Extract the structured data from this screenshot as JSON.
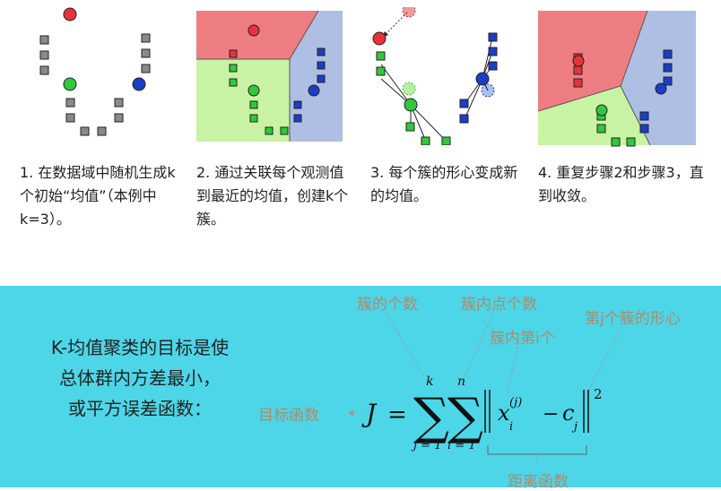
{
  "steps": [
    {
      "caption": "1. 在数据域中随机生成k个初始“均值”（本例中k=3）。"
    },
    {
      "caption": "2. 通过关联每个观测值到最近的均值，创建k个簇。"
    },
    {
      "caption": "3. 每个簇的形心变成新的均值。"
    },
    {
      "caption": "4. 重复步骤2和步骤3，直到收敛。"
    }
  ],
  "objective": {
    "line1": "K-均值聚类的目标是使",
    "line2": "总体群内方差最小，",
    "line3": "或平方误差函数："
  },
  "formula_labels": {
    "cluster_count": "簇的个数",
    "points_in_cluster": "簇内点个数",
    "ith_in_cluster": "簇内第i个",
    "jth_centroid": "第j个簇的形心",
    "objective_function": "目标函数",
    "distance_function": "距离函数"
  },
  "formula": {
    "J": "J",
    "eq": "=",
    "k": "k",
    "n": "n",
    "j1": "j = 1",
    "i1": "i = 1",
    "x": "x",
    "sub_i": "i",
    "sup_j": "(j)",
    "minus": "−",
    "c": "c",
    "sub_j": "j",
    "sq": "2"
  },
  "colors": {
    "red": "#e8323a",
    "green": "#30c93a",
    "blue": "#1a3ec8",
    "gray": "#8a8a8a",
    "red_region": "#ee7d82",
    "green_region": "#c8f2a4",
    "blue_region": "#aebfe3",
    "bottom_bg": "#4dd6e8",
    "label": "#b08a6a"
  }
}
